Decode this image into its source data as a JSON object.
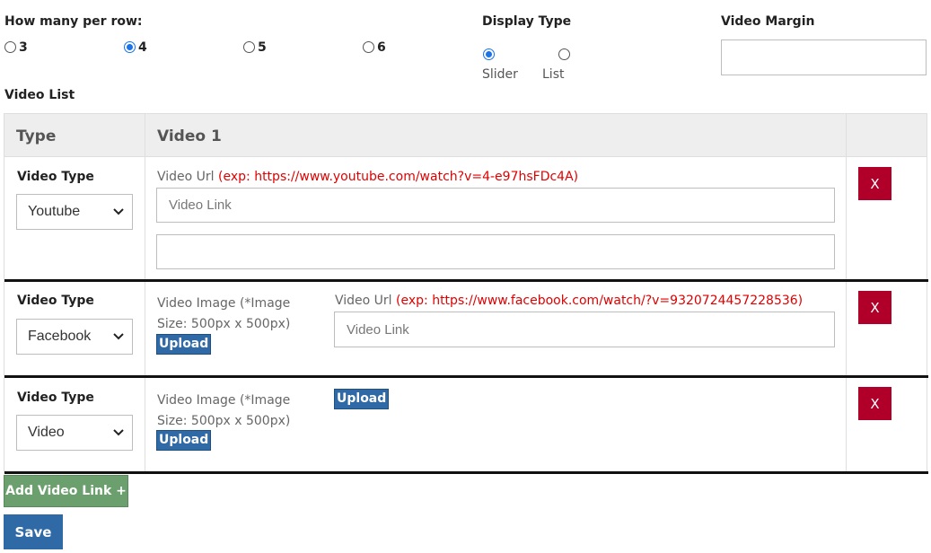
{
  "per_row": {
    "label": "How many per row:",
    "options": [
      {
        "value": "3",
        "checked": false
      },
      {
        "value": "4",
        "checked": true
      },
      {
        "value": "5",
        "checked": false
      },
      {
        "value": "6",
        "checked": false
      }
    ]
  },
  "display_type": {
    "label": "Display Type",
    "options": [
      {
        "value": "Slider",
        "checked": true
      },
      {
        "value": "List",
        "checked": false
      }
    ]
  },
  "video_margin": {
    "label": "Video Margin",
    "value": ""
  },
  "video_list": {
    "label": "Video List",
    "headers": [
      "Type",
      "Video 1",
      ""
    ],
    "rows": [
      {
        "type_label": "Video Type",
        "type_value": "Youtube",
        "url_label": "Video Url",
        "url_example": "(exp: https://www.youtube.com/watch?v=4-e97hsFDc4A)",
        "url_placeholder": "Video Link",
        "extra_value": "",
        "remove_label": "X"
      },
      {
        "type_label": "Video Type",
        "type_value": "Facebook",
        "image_label": "Video Image (*Image Size: 500px x 500px)",
        "image_upload": "Upload",
        "url_label": "Video Url",
        "url_example": "(exp: https://www.facebook.com/watch/?v=9320724457228536)",
        "url_placeholder": "Video Link",
        "remove_label": "X"
      },
      {
        "type_label": "Video Type",
        "type_value": "Video",
        "image_label": "Video Image (*Image Size: 500px x 500px)",
        "image_upload": "Upload",
        "video_upload": "Upload",
        "remove_label": "X"
      }
    ]
  },
  "actions": {
    "add_label": "Add Video Link +",
    "save_label": "Save"
  },
  "colors": {
    "accent": "#1a73e8",
    "danger": "#b0002a",
    "success": "#6c9f6e",
    "primary": "#2f6aa6",
    "example_text": "#e00000"
  }
}
